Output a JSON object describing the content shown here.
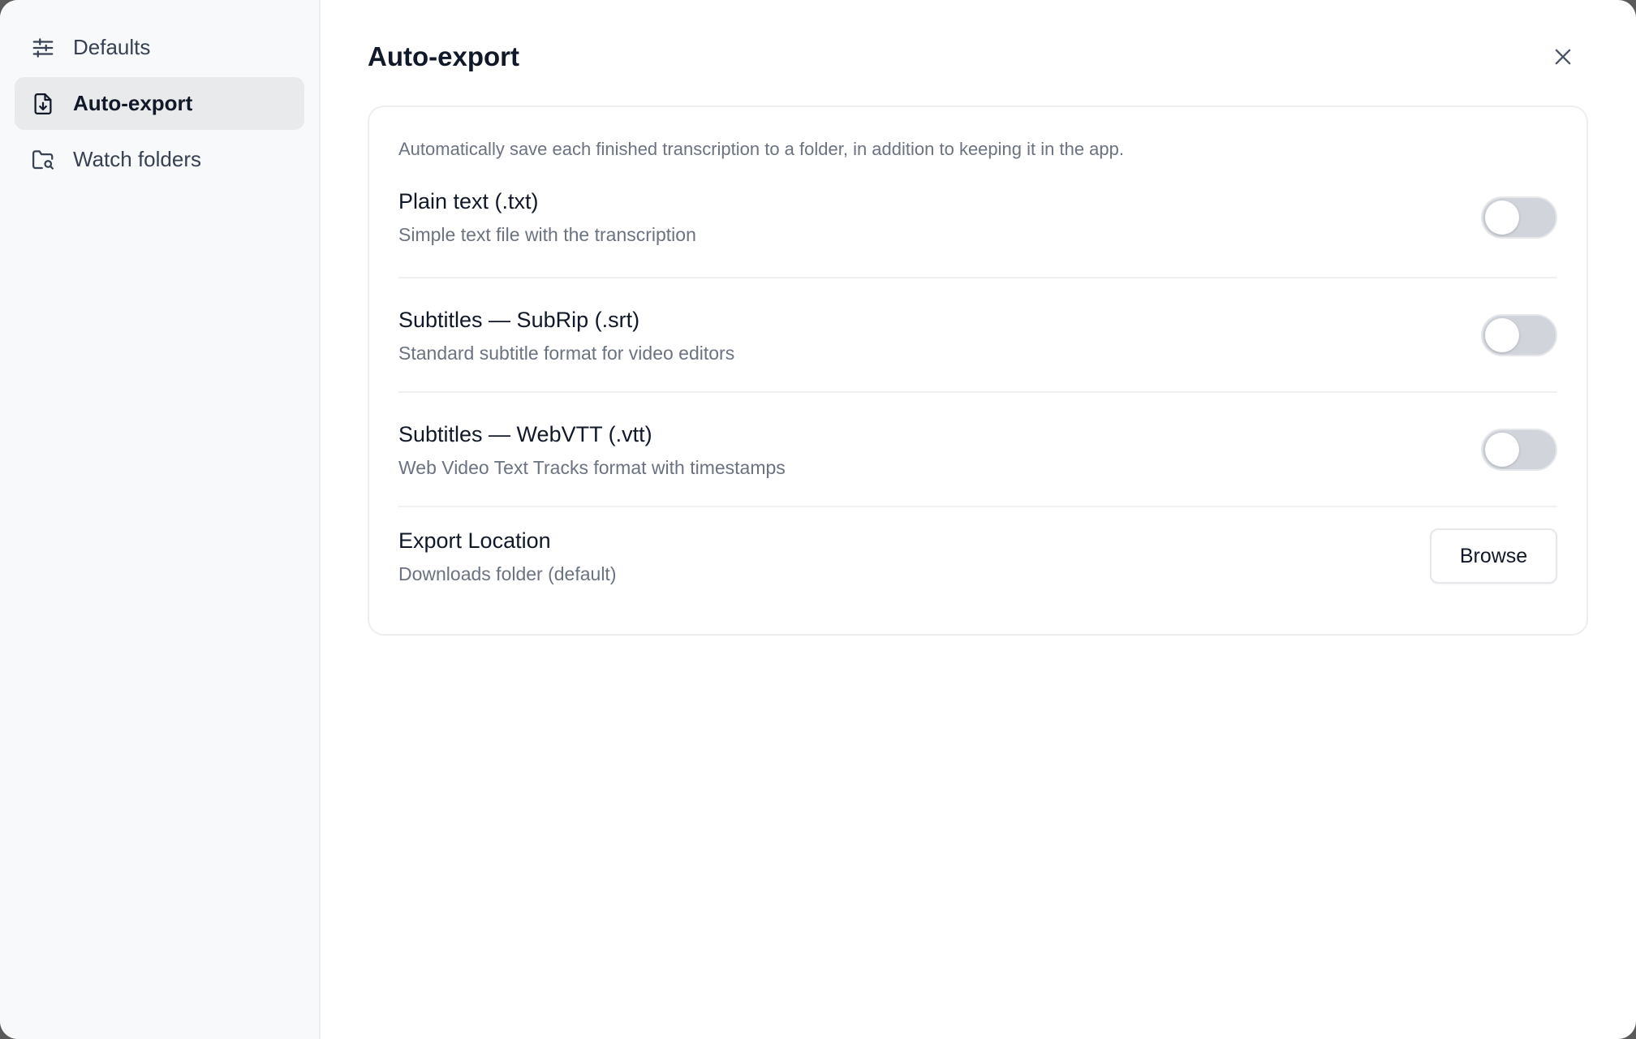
{
  "sidebar": {
    "items": [
      {
        "label": "Defaults",
        "icon": "sliders-icon",
        "active": false
      },
      {
        "label": "Auto-export",
        "icon": "file-download-icon",
        "active": true
      },
      {
        "label": "Watch folders",
        "icon": "folder-search-icon",
        "active": false
      }
    ]
  },
  "main": {
    "title": "Auto-export",
    "close_icon": "close-icon",
    "intro": "Automatically save each finished transcription to a folder, in addition to keeping it in the app.",
    "options": [
      {
        "title": "Plain text (.txt)",
        "description": "Simple text file with the transcription",
        "enabled": false
      },
      {
        "title": "Subtitles — SubRip (.srt)",
        "description": "Standard subtitle format for video editors",
        "enabled": false
      },
      {
        "title": "Subtitles — WebVTT (.vtt)",
        "description": "Web Video Text Tracks format with timestamps",
        "enabled": false
      }
    ],
    "export_location": {
      "title": "Export Location",
      "value": "Downloads folder (default)",
      "button_label": "Browse"
    }
  },
  "colors": {
    "sidebar_bg": "#f8f9fb",
    "active_item_bg": "#e9eaec",
    "toggle_off": "#d1d5db",
    "muted_text": "#6b7280"
  }
}
